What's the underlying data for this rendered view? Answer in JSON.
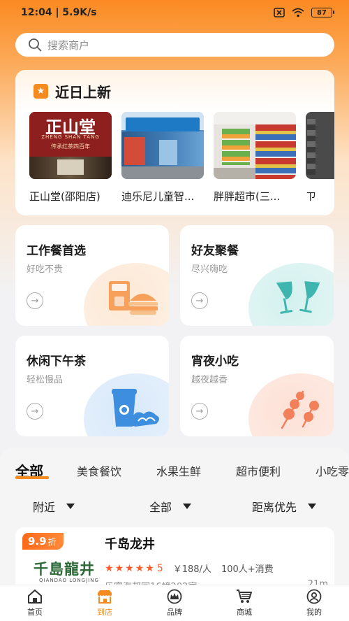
{
  "status": {
    "time_speed": "12:04 | 5.9K/s",
    "battery": "87"
  },
  "search": {
    "placeholder": "搜索商户"
  },
  "new_arrivals": {
    "title": "近日上新",
    "shops": [
      {
        "name": "正山堂(邵阳店)",
        "sign_main": "正山堂",
        "sign_pinyin": "ZHENG SHAN TANG",
        "sign_slogan": "传承红茶四百年"
      },
      {
        "name": "迪乐尼儿童智..."
      },
      {
        "name": "胖胖超市(三..."
      },
      {
        "name": "ㄗ"
      }
    ]
  },
  "categories": [
    {
      "title": "工作餐首选",
      "subtitle": "好吃不贵",
      "icon": "meal-combo-icon",
      "color": "#f6a05c"
    },
    {
      "title": "好友聚餐",
      "subtitle": "尽兴嗨吃",
      "icon": "cheers-glasses-icon",
      "color": "#3fb5b0"
    },
    {
      "title": "休闲下午茶",
      "subtitle": "轻松慢品",
      "icon": "coffee-croissant-icon",
      "color": "#3e8ee0"
    },
    {
      "title": "宵夜小吃",
      "subtitle": "越夜越香",
      "icon": "skewer-snack-icon",
      "color": "#f2805a"
    }
  ],
  "tabs": [
    "全部",
    "美食餐饮",
    "水果生鲜",
    "超市便利",
    "小吃零"
  ],
  "filters": [
    "附近",
    "全部",
    "距离优先"
  ],
  "store": {
    "discount_value": "9.9",
    "discount_unit": "折",
    "logo_text": "千島龍井",
    "logo_sub": "QIANDAO LONGJING",
    "name": "千岛龙井",
    "rating": "5",
    "price": "￥188/人",
    "sales": "100人+消费",
    "address": "乐富海邦园16幢202室",
    "distance": "21m"
  },
  "bottom_nav": [
    {
      "label": "首页",
      "icon": "home-icon"
    },
    {
      "label": "到店",
      "icon": "store-icon",
      "active": true
    },
    {
      "label": "品牌",
      "icon": "crown-icon"
    },
    {
      "label": "商城",
      "icon": "cart-icon"
    },
    {
      "label": "我的",
      "icon": "profile-icon"
    }
  ],
  "accent": "#f58a1f"
}
